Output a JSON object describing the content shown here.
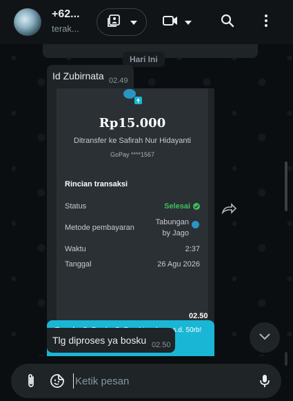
{
  "header": {
    "contact_name": "+62...",
    "contact_status": "terak...",
    "icons": [
      "gallery-icon",
      "chevron-down-icon",
      "video-call-icon",
      "chevron-down-icon",
      "search-icon",
      "more-vert-icon"
    ]
  },
  "chat": {
    "date_label": "Hari Ini",
    "messages": [
      {
        "text": "Id Zubirnata",
        "time": "02.49"
      },
      {
        "time": "02.50"
      },
      {
        "text": "Tlg diproses ya bosku",
        "time": "02.50"
      }
    ],
    "receipt": {
      "amount": "Rp15.000",
      "recipient": "Ditransfer ke Safirah Nur Hidayanti",
      "account": "GoPay ****1567",
      "details_title": "Rincian transaksi",
      "rows": [
        {
          "label": "Status",
          "value": "Selesai"
        },
        {
          "label": "Metode pembayaran",
          "value_line1": "Tabungan",
          "value_line2": "by Jago"
        },
        {
          "label": "Waktu",
          "value": "2:37"
        },
        {
          "label": "Tanggal",
          "value": "26 Agu 2026"
        }
      ],
      "promo": "Transfer GoPay ke GoPay, bisa dapet s.d. 50rb!"
    }
  },
  "composer": {
    "placeholder": "Ketik pesan"
  },
  "colors": {
    "background": "#0b0e10",
    "bubble": "#1f2427",
    "accent_green": "#3fbf5a",
    "promo_blue": "#1ab6d5"
  }
}
